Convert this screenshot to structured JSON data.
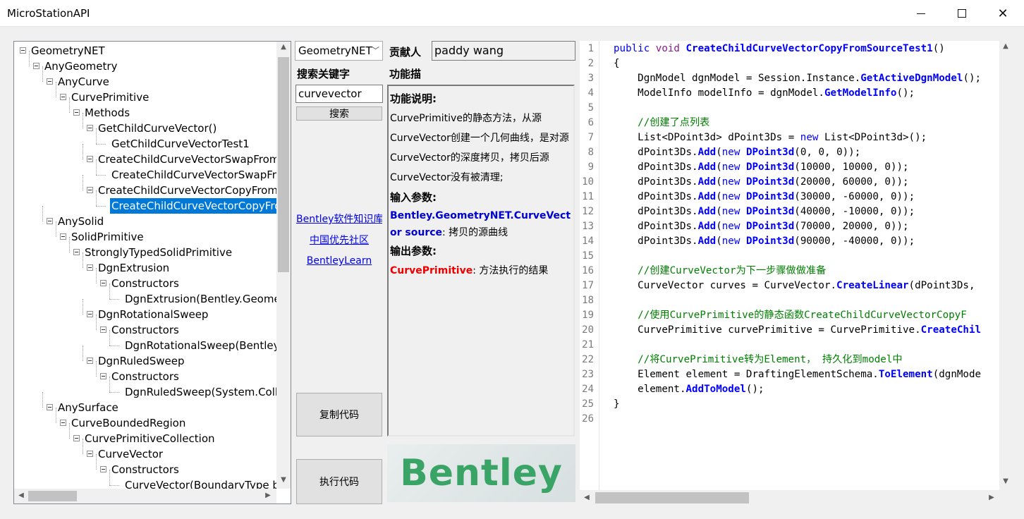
{
  "window": {
    "title": "MicroStationAPI"
  },
  "tree": {
    "nodes": [
      {
        "label": "GeometryNET",
        "depth": 0,
        "toggle": true
      },
      {
        "label": "AnyGeometry",
        "depth": 1,
        "toggle": true
      },
      {
        "label": "AnyCurve",
        "depth": 2,
        "toggle": true
      },
      {
        "label": "CurvePrimitive",
        "depth": 3,
        "toggle": true
      },
      {
        "label": "Methods",
        "depth": 4,
        "toggle": true
      },
      {
        "label": "GetChildCurveVector()",
        "depth": 5,
        "toggle": true
      },
      {
        "label": "GetChildCurveVectorTest1",
        "depth": 6,
        "toggle": false
      },
      {
        "label": "CreateChildCurveVectorSwapFrom",
        "depth": 5,
        "toggle": true
      },
      {
        "label": "CreateChildCurveVectorSwapFro",
        "depth": 6,
        "toggle": false
      },
      {
        "label": "CreateChildCurveVectorCopyFrom",
        "depth": 5,
        "toggle": true
      },
      {
        "label": "CreateChildCurveVectorCopyFro",
        "depth": 6,
        "toggle": false,
        "selected": true
      },
      {
        "label": "AnySolid",
        "depth": 2,
        "toggle": true
      },
      {
        "label": "SolidPrimitive",
        "depth": 3,
        "toggle": true
      },
      {
        "label": "StronglyTypedSolidPrimitive",
        "depth": 4,
        "toggle": true
      },
      {
        "label": "DgnExtrusion",
        "depth": 5,
        "toggle": true
      },
      {
        "label": "Constructors",
        "depth": 6,
        "toggle": true
      },
      {
        "label": "DgnExtrusion(Bentley.Geome",
        "depth": 7,
        "toggle": false
      },
      {
        "label": "DgnRotationalSweep",
        "depth": 5,
        "toggle": true
      },
      {
        "label": "Constructors",
        "depth": 6,
        "toggle": true
      },
      {
        "label": "DgnRotationalSweep(Bentley",
        "depth": 7,
        "toggle": false
      },
      {
        "label": "DgnRuledSweep",
        "depth": 5,
        "toggle": true
      },
      {
        "label": "Constructors",
        "depth": 6,
        "toggle": true
      },
      {
        "label": "DgnRuledSweep(System.Colle",
        "depth": 7,
        "toggle": false
      },
      {
        "label": "AnySurface",
        "depth": 2,
        "toggle": true
      },
      {
        "label": "CurveBoundedRegion",
        "depth": 3,
        "toggle": true
      },
      {
        "label": "CurvePrimitiveCollection",
        "depth": 4,
        "toggle": true
      },
      {
        "label": "CurveVector",
        "depth": 5,
        "toggle": true
      },
      {
        "label": "Constructors",
        "depth": 6,
        "toggle": true
      },
      {
        "label": "CurveVector(BoundaryType b",
        "depth": 7,
        "toggle": false
      }
    ]
  },
  "controls": {
    "namespace_combo": "GeometryNET",
    "contributor_label": "贡献人",
    "contributor_value": "paddy wang",
    "search_label": "搜索关键字",
    "feature_label": "功能描",
    "search_value": "curvevector",
    "search_button": "搜索",
    "link_knowledge": "Bentley软件知识库",
    "link_community": "中国优先社区",
    "link_learn": "BentleyLearn",
    "copy_button": "复制代码",
    "run_button": "执行代码",
    "logo_text": "Bentley"
  },
  "description": {
    "heading_func": "功能说明:",
    "func_text": "CurvePrimitive的静态方法，从源CurveVector创建一个几何曲线，是对源CurveVector的深度拷贝，拷贝后源CurveVector没有被清理;",
    "heading_input": "输入参数:",
    "input_type": "Bentley.GeometryNET.CurveVector source",
    "input_desc": ": 拷贝的源曲线",
    "heading_output": "输出参数:",
    "output_type": "CurvePrimitive",
    "output_desc": ": 方法执行的结果"
  },
  "code": {
    "line_numbers": [
      "1",
      "2",
      "3",
      "4",
      "5",
      "6",
      "7",
      "8",
      "9",
      "10",
      "11",
      "12",
      "13",
      "14",
      "15",
      "16",
      "17",
      "18",
      "19",
      "20",
      "21",
      "22",
      "23",
      "24",
      "25",
      "26"
    ],
    "lines": [
      [
        [
          "kw",
          "public "
        ],
        [
          "mt",
          "void "
        ],
        [
          "fn",
          "CreateChildCurveVectorCopyFromSourceTest1"
        ],
        [
          "pl",
          "()"
        ]
      ],
      [
        [
          "pl",
          "{"
        ]
      ],
      [
        [
          "pl",
          "    DgnModel dgnModel = Session.Instance."
        ],
        [
          "fn",
          "GetActiveDgnModel"
        ],
        [
          "pl",
          "();"
        ]
      ],
      [
        [
          "pl",
          "    ModelInfo modelInfo = dgnModel."
        ],
        [
          "fn",
          "GetModelInfo"
        ],
        [
          "pl",
          "();"
        ]
      ],
      [
        [
          "pl",
          ""
        ]
      ],
      [
        [
          "cm",
          "    //创建了点列表"
        ]
      ],
      [
        [
          "pl",
          "    List<DPoint3d> dPoint3Ds = "
        ],
        [
          "kw",
          "new "
        ],
        [
          "pl",
          "List<DPoint3d>();"
        ]
      ],
      [
        [
          "pl",
          "    dPoint3Ds."
        ],
        [
          "fn",
          "Add"
        ],
        [
          "pl",
          "("
        ],
        [
          "kw",
          "new "
        ],
        [
          "fn",
          "DPoint3d"
        ],
        [
          "pl",
          "(0, 0, 0));"
        ]
      ],
      [
        [
          "pl",
          "    dPoint3Ds."
        ],
        [
          "fn",
          "Add"
        ],
        [
          "pl",
          "("
        ],
        [
          "kw",
          "new "
        ],
        [
          "fn",
          "DPoint3d"
        ],
        [
          "pl",
          "(10000, 10000, 0));"
        ]
      ],
      [
        [
          "pl",
          "    dPoint3Ds."
        ],
        [
          "fn",
          "Add"
        ],
        [
          "pl",
          "("
        ],
        [
          "kw",
          "new "
        ],
        [
          "fn",
          "DPoint3d"
        ],
        [
          "pl",
          "(20000, 60000, 0));"
        ]
      ],
      [
        [
          "pl",
          "    dPoint3Ds."
        ],
        [
          "fn",
          "Add"
        ],
        [
          "pl",
          "("
        ],
        [
          "kw",
          "new "
        ],
        [
          "fn",
          "DPoint3d"
        ],
        [
          "pl",
          "(30000, -60000, 0));"
        ]
      ],
      [
        [
          "pl",
          "    dPoint3Ds."
        ],
        [
          "fn",
          "Add"
        ],
        [
          "pl",
          "("
        ],
        [
          "kw",
          "new "
        ],
        [
          "fn",
          "DPoint3d"
        ],
        [
          "pl",
          "(40000, -10000, 0));"
        ]
      ],
      [
        [
          "pl",
          "    dPoint3Ds."
        ],
        [
          "fn",
          "Add"
        ],
        [
          "pl",
          "("
        ],
        [
          "kw",
          "new "
        ],
        [
          "fn",
          "DPoint3d"
        ],
        [
          "pl",
          "(70000, 20000, 0));"
        ]
      ],
      [
        [
          "pl",
          "    dPoint3Ds."
        ],
        [
          "fn",
          "Add"
        ],
        [
          "pl",
          "("
        ],
        [
          "kw",
          "new "
        ],
        [
          "fn",
          "DPoint3d"
        ],
        [
          "pl",
          "(90000, -40000, 0));"
        ]
      ],
      [
        [
          "pl",
          ""
        ]
      ],
      [
        [
          "cm",
          "    //创建CurveVector为下一步骤做做准备"
        ]
      ],
      [
        [
          "pl",
          "    CurveVector curves = CurveVector."
        ],
        [
          "fn",
          "CreateLinear"
        ],
        [
          "pl",
          "(dPoint3Ds,"
        ]
      ],
      [
        [
          "pl",
          ""
        ]
      ],
      [
        [
          "cm",
          "    //使用CurvePrimitive的静态函数CreateChildCurveVectorCopyF"
        ]
      ],
      [
        [
          "pl",
          "    CurvePrimitive curvePrimitive = CurvePrimitive."
        ],
        [
          "fn",
          "CreateChil"
        ]
      ],
      [
        [
          "pl",
          ""
        ]
      ],
      [
        [
          "cm",
          "    //将CurvePrimitive转为Element， 持久化到model中"
        ]
      ],
      [
        [
          "pl",
          "    Element element = DraftingElementSchema."
        ],
        [
          "fn",
          "ToElement"
        ],
        [
          "pl",
          "(dgnMode"
        ]
      ],
      [
        [
          "pl",
          "    element."
        ],
        [
          "fn",
          "AddToModel"
        ],
        [
          "pl",
          "();"
        ]
      ],
      [
        [
          "pl",
          "}"
        ]
      ],
      [
        [
          "pl",
          ""
        ]
      ]
    ]
  }
}
